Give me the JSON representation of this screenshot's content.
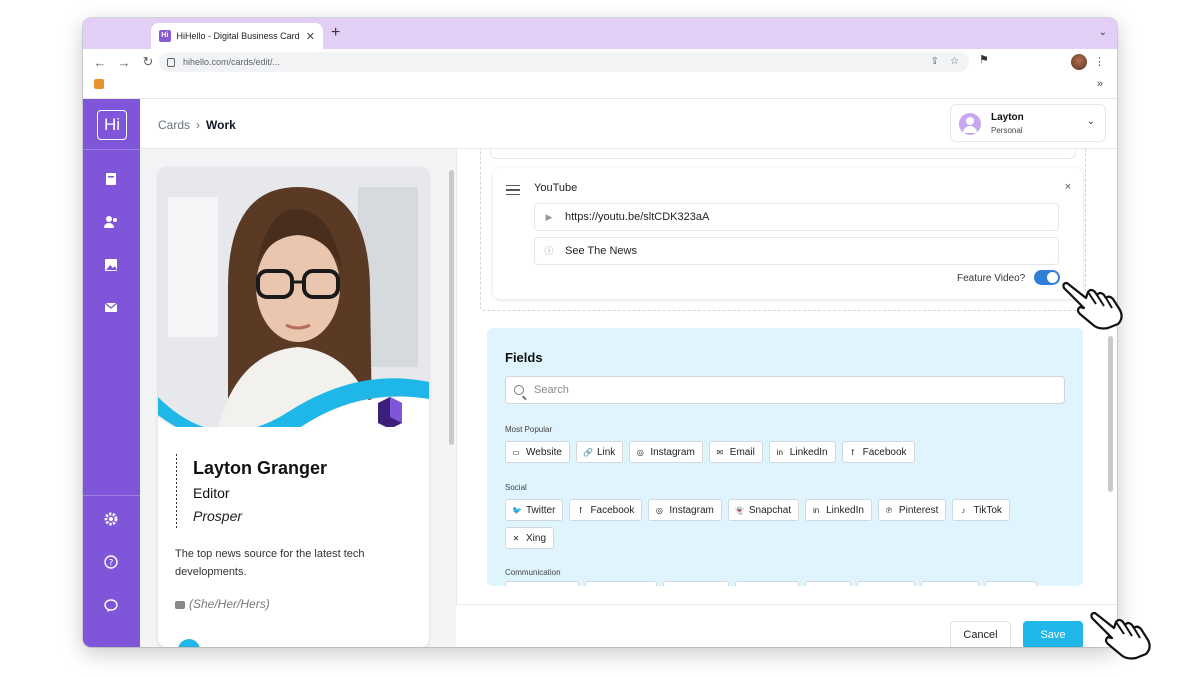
{
  "browser": {
    "tab_title": "HiHello - Digital Business Card",
    "tab_favicon": "Hi",
    "new_tab": "+",
    "url": "hihello.com/cards/edit/...",
    "bookmarks_more": "»"
  },
  "app": {
    "logo": "Hi",
    "accent": "#7f56d9",
    "sidebar": {
      "items": [
        "cards-icon",
        "contacts-icon",
        "backgrounds-icon",
        "email-signature-icon"
      ],
      "bottom": [
        "settings-icon",
        "help-icon",
        "chat-icon"
      ],
      "expand": "›"
    },
    "breadcrumb": {
      "root": "Cards",
      "sep": "›",
      "current": "Work"
    },
    "profile": {
      "name": "Layton",
      "subtitle": "Personal",
      "chevron": "⌄"
    }
  },
  "card": {
    "name": "Layton Granger",
    "title": "Editor",
    "company": "Prosper",
    "bio": "The top news source for the latest tech developments.",
    "pronouns": "(She/Her/Hers)",
    "wave_color": "#1fb6e8"
  },
  "youtube": {
    "label": "YouTube",
    "close": "×",
    "url_value": "https://youtu.be/sltCDK323aA",
    "title_value": "See The News",
    "feature_label": "Feature Video?",
    "feature_on": true
  },
  "fields": {
    "title": "Fields",
    "search_placeholder": "Search",
    "sections": [
      {
        "label": "Most Popular",
        "chips": [
          {
            "icon": "▭",
            "label": "Website"
          },
          {
            "icon": "🔗",
            "label": "Link"
          },
          {
            "icon": "◎",
            "label": "Instagram"
          },
          {
            "icon": "✉",
            "label": "Email"
          },
          {
            "icon": "in",
            "label": "LinkedIn"
          },
          {
            "icon": "f",
            "label": "Facebook"
          }
        ]
      },
      {
        "label": "Social",
        "chips": [
          {
            "icon": "🐦",
            "label": "Twitter"
          },
          {
            "icon": "f",
            "label": "Facebook"
          },
          {
            "icon": "◎",
            "label": "Instagram"
          },
          {
            "icon": "👻",
            "label": "Snapchat"
          },
          {
            "icon": "in",
            "label": "LinkedIn"
          },
          {
            "icon": "℗",
            "label": "Pinterest"
          },
          {
            "icon": "♪",
            "label": "TikTok"
          }
        ]
      },
      {
        "label": "",
        "chips": [
          {
            "icon": "✕",
            "label": "Xing"
          }
        ]
      },
      {
        "label": "Communication",
        "chips": []
      }
    ]
  },
  "footer": {
    "cancel": "Cancel",
    "save": "Save"
  }
}
